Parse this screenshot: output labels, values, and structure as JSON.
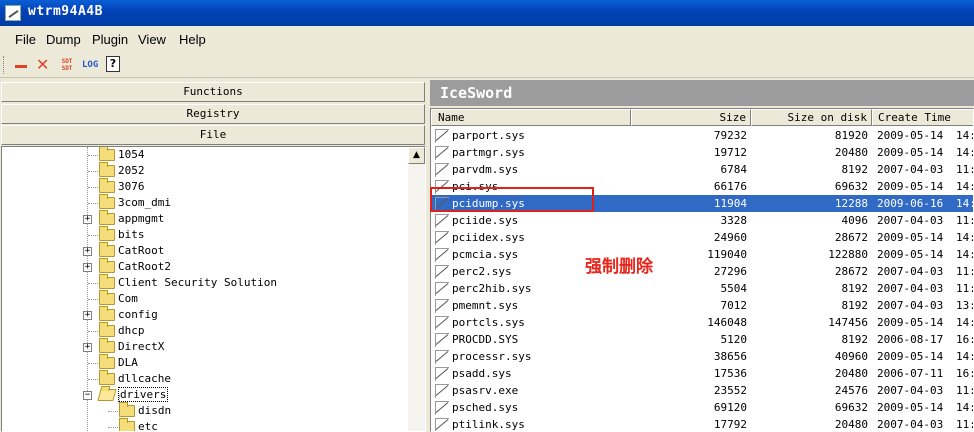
{
  "window": {
    "title": "wtrm94A4B"
  },
  "menu": [
    "File",
    "Dump",
    "Plugin",
    "View",
    "Help"
  ],
  "toolbar": {
    "sdt_label": "SDT SDT",
    "log_label": "LOG",
    "help_label": "?"
  },
  "left": {
    "categories": [
      "Functions",
      "Registry",
      "File"
    ],
    "tree": [
      {
        "label": "1054",
        "expander": ""
      },
      {
        "label": "2052",
        "expander": ""
      },
      {
        "label": "3076",
        "expander": ""
      },
      {
        "label": "3com_dmi",
        "expander": ""
      },
      {
        "label": "appmgmt",
        "expander": "+"
      },
      {
        "label": "bits",
        "expander": ""
      },
      {
        "label": "CatRoot",
        "expander": "+"
      },
      {
        "label": "CatRoot2",
        "expander": "+"
      },
      {
        "label": "Client Security Solution",
        "expander": ""
      },
      {
        "label": "Com",
        "expander": ""
      },
      {
        "label": "config",
        "expander": "+"
      },
      {
        "label": "dhcp",
        "expander": ""
      },
      {
        "label": "DirectX",
        "expander": "+"
      },
      {
        "label": "DLA",
        "expander": ""
      },
      {
        "label": "dllcache",
        "expander": ""
      },
      {
        "label": "drivers",
        "expander": "−",
        "selected": true
      },
      {
        "label": "disdn",
        "expander": "",
        "child": true
      },
      {
        "label": "etc",
        "expander": "",
        "child": true
      }
    ]
  },
  "right": {
    "banner": "IceSword",
    "columns": [
      "Name",
      "Size",
      "Size on disk",
      "Create Time"
    ],
    "rows": [
      {
        "name": "parport.sys",
        "size": "79232",
        "disk": "81920",
        "date": "2009-05-14",
        "time": "14:"
      },
      {
        "name": "partmgr.sys",
        "size": "19712",
        "disk": "20480",
        "date": "2009-05-14",
        "time": "14:"
      },
      {
        "name": "parvdm.sys",
        "size": "6784",
        "disk": "8192",
        "date": "2007-04-03",
        "time": "11:"
      },
      {
        "name": "pci.sys",
        "size": "66176",
        "disk": "69632",
        "date": "2009-05-14",
        "time": "14:"
      },
      {
        "name": "pcidump.sys",
        "size": "11904",
        "disk": "12288",
        "date": "2009-06-16",
        "time": "14:",
        "selected": true
      },
      {
        "name": "pciide.sys",
        "size": "3328",
        "disk": "4096",
        "date": "2007-04-03",
        "time": "11:"
      },
      {
        "name": "pciidex.sys",
        "size": "24960",
        "disk": "28672",
        "date": "2009-05-14",
        "time": "14:"
      },
      {
        "name": "pcmcia.sys",
        "size": "119040",
        "disk": "122880",
        "date": "2009-05-14",
        "time": "14:"
      },
      {
        "name": "perc2.sys",
        "size": "27296",
        "disk": "28672",
        "date": "2007-04-03",
        "time": "11:"
      },
      {
        "name": "perc2hib.sys",
        "size": "5504",
        "disk": "8192",
        "date": "2007-04-03",
        "time": "11:"
      },
      {
        "name": "pmemnt.sys",
        "size": "7012",
        "disk": "8192",
        "date": "2007-04-03",
        "time": "13:"
      },
      {
        "name": "portcls.sys",
        "size": "146048",
        "disk": "147456",
        "date": "2009-05-14",
        "time": "14:"
      },
      {
        "name": "PROCDD.SYS",
        "size": "5120",
        "disk": "8192",
        "date": "2006-08-17",
        "time": "16:"
      },
      {
        "name": "processr.sys",
        "size": "38656",
        "disk": "40960",
        "date": "2009-05-14",
        "time": "14:"
      },
      {
        "name": "psadd.sys",
        "size": "17536",
        "disk": "20480",
        "date": "2006-07-11",
        "time": "16:"
      },
      {
        "name": "psasrv.exe",
        "size": "23552",
        "disk": "24576",
        "date": "2007-04-03",
        "time": "11:"
      },
      {
        "name": "psched.sys",
        "size": "69120",
        "disk": "69632",
        "date": "2009-05-14",
        "time": "14:"
      },
      {
        "name": "ptilink.sys",
        "size": "17792",
        "disk": "20480",
        "date": "2007-04-03",
        "time": "11:"
      }
    ]
  },
  "annotation": "强制删除"
}
